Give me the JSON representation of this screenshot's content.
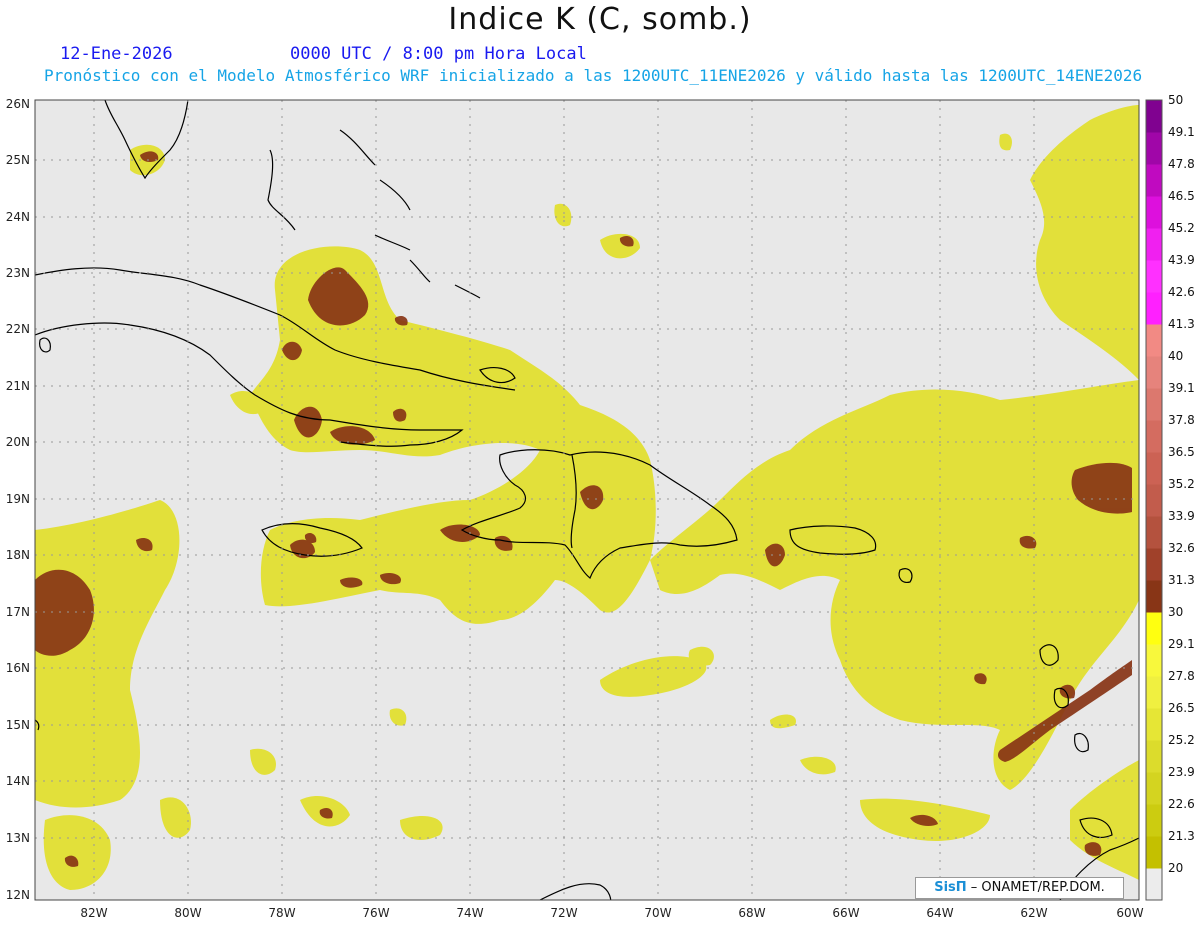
{
  "header": {
    "title": "Indice K (C, somb.)",
    "date": "12-Ene-2026",
    "time": "0000 UTC / 8:00 pm Hora Local",
    "subtitle": "Pronóstico con el Modelo Atmosférico WRF inicializado a las 1200UTC_11ENE2026 y válido hasta las  1200UTC_14ENE2026"
  },
  "map": {
    "lat_labels": [
      "26N",
      "25N",
      "24N",
      "23N",
      "22N",
      "21N",
      "20N",
      "19N",
      "18N",
      "17N",
      "16N",
      "15N",
      "14N",
      "13N",
      "12N"
    ],
    "lon_labels": [
      "82W",
      "80W",
      "78W",
      "76W",
      "74W",
      "72W",
      "70W",
      "68W",
      "66W",
      "64W",
      "62W",
      "60W"
    ],
    "background_color": "#e8e8e8",
    "grid": true
  },
  "colorbar": {
    "levels": [
      "20",
      "21.3",
      "22.6",
      "23.9",
      "25.2",
      "26.5",
      "27.8",
      "29.1",
      "30",
      "31.3",
      "32.6",
      "33.9",
      "35.2",
      "36.5",
      "37.8",
      "39.1",
      "40",
      "41.3",
      "42.6",
      "43.9",
      "45.2",
      "46.5",
      "47.8",
      "49.1",
      "50"
    ],
    "colors": [
      "#c4c000",
      "#cccc10",
      "#d4d420",
      "#dcdc2c",
      "#e6e635",
      "#f0f040",
      "#f8f83c",
      "#ffff10",
      "#883516",
      "#a0412a",
      "#b4523e",
      "#c25c4c",
      "#cc6254",
      "#d46c60",
      "#dc786e",
      "#e6837c",
      "#f28a84",
      "#ff20ff",
      "#ff30ff",
      "#f020f0",
      "#dd10dd",
      "#c00ac0",
      "#a006a8",
      "#800290",
      "#64026e"
    ]
  },
  "credit": {
    "sis": "SisΠ",
    "text": " – ONAMET/REP.DOM."
  }
}
